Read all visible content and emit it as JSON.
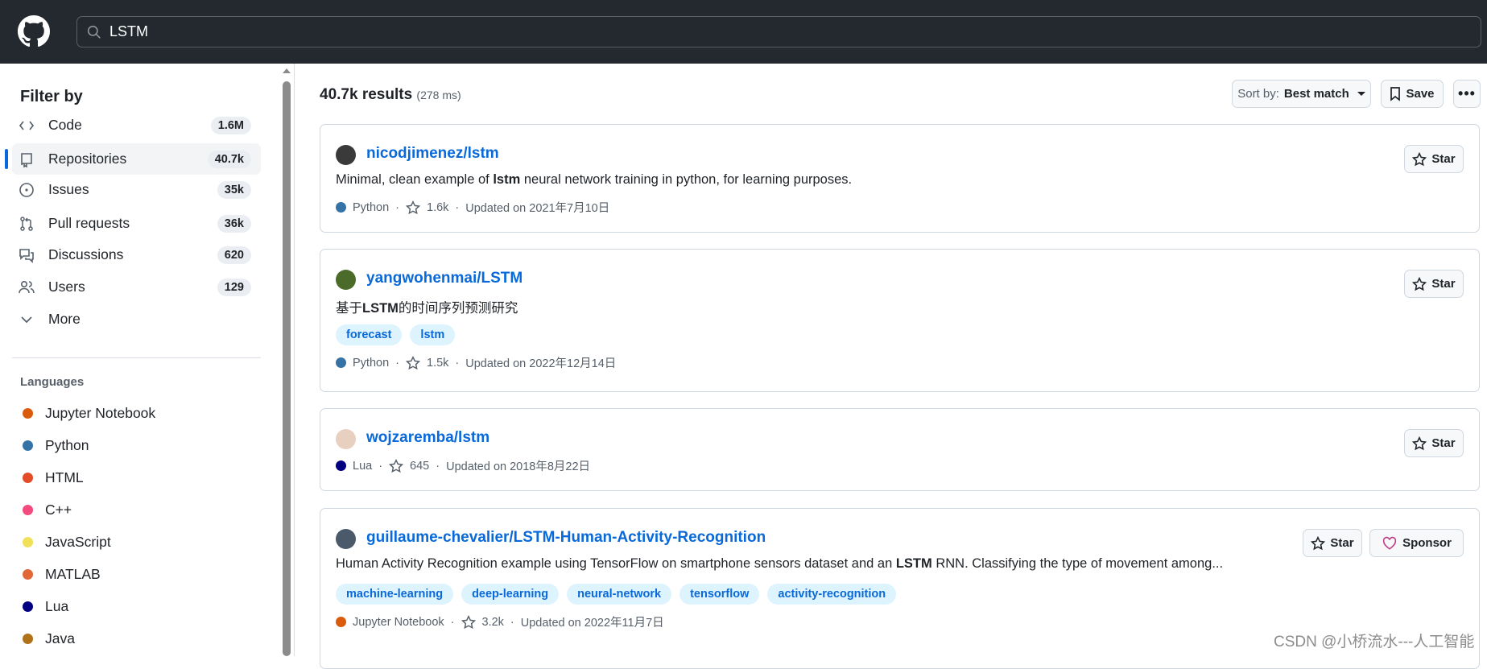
{
  "header": {
    "search_value": "LSTM",
    "logo": "github-logo"
  },
  "sidebar": {
    "title": "Filter by",
    "items": [
      {
        "label": "Code",
        "count": "1.6M",
        "icon": "code-icon"
      },
      {
        "label": "Repositories",
        "count": "40.7k",
        "icon": "repo-icon",
        "selected": true
      },
      {
        "label": "Issues",
        "count": "35k",
        "icon": "issue-icon"
      },
      {
        "label": "Pull requests",
        "count": "36k",
        "icon": "pull-request-icon"
      },
      {
        "label": "Discussions",
        "count": "620",
        "icon": "discussion-icon"
      },
      {
        "label": "Users",
        "count": "129",
        "icon": "users-icon"
      },
      {
        "label": "More",
        "count": null,
        "icon": "chevron-down-icon"
      }
    ],
    "languages_title": "Languages",
    "languages": [
      {
        "label": "Jupyter Notebook",
        "color": "#DA5B0B"
      },
      {
        "label": "Python",
        "color": "#3572A5"
      },
      {
        "label": "HTML",
        "color": "#E34C26"
      },
      {
        "label": "C++",
        "color": "#F34B7D"
      },
      {
        "label": "JavaScript",
        "color": "#F1E05A"
      },
      {
        "label": "MATLAB",
        "color": "#E16737"
      },
      {
        "label": "Lua",
        "color": "#000080"
      },
      {
        "label": "Java",
        "color": "#B07219"
      }
    ]
  },
  "results": {
    "count": "40.7k results",
    "time": "(278 ms)",
    "sort_prefix": "Sort by:",
    "sort_value": "Best match",
    "save": "Save"
  },
  "repos": [
    {
      "name": "nicodjimenez/lstm",
      "desc_pre": "Minimal, clean example of ",
      "desc_bold": "lstm",
      "desc_post": " neural network training in python, for learning purposes.",
      "tags": [],
      "language": "Python",
      "lang_color": "#3572A5",
      "stars": "1.6k",
      "updated": "Updated on 2021年7月10日",
      "star_label": "Star"
    },
    {
      "name": "yangwohenmai/LSTM",
      "desc_pre": "基于",
      "desc_bold": "LSTM",
      "desc_post": "的时间序列预测研究",
      "tags": [
        "forecast",
        "lstm"
      ],
      "language": "Python",
      "lang_color": "#3572A5",
      "stars": "1.5k",
      "updated": "Updated on 2022年12月14日",
      "star_label": "Star"
    },
    {
      "name": "wojzaremba/lstm",
      "desc_pre": "",
      "desc_bold": "",
      "desc_post": "",
      "tags": [],
      "language": "Lua",
      "lang_color": "#000080",
      "stars": "645",
      "updated": "Updated on 2018年8月22日",
      "star_label": "Star"
    },
    {
      "name": "guillaume-chevalier/LSTM-Human-Activity-Recognition",
      "desc_pre": "Human Activity Recognition example using TensorFlow on smartphone sensors dataset and an ",
      "desc_bold": "LSTM",
      "desc_post": " RNN. Classifying the type of movement among...",
      "tags": [
        "machine-learning",
        "deep-learning",
        "neural-network",
        "tensorflow",
        "activity-recognition"
      ],
      "language": "Jupyter Notebook",
      "lang_color": "#DA5B0B",
      "stars": "3.2k",
      "updated": "Updated on 2022年11月7日",
      "star_label": "Star",
      "sponsor_label": "Sponsor"
    }
  ],
  "watermark": "CSDN @小桥流水---人工智能"
}
